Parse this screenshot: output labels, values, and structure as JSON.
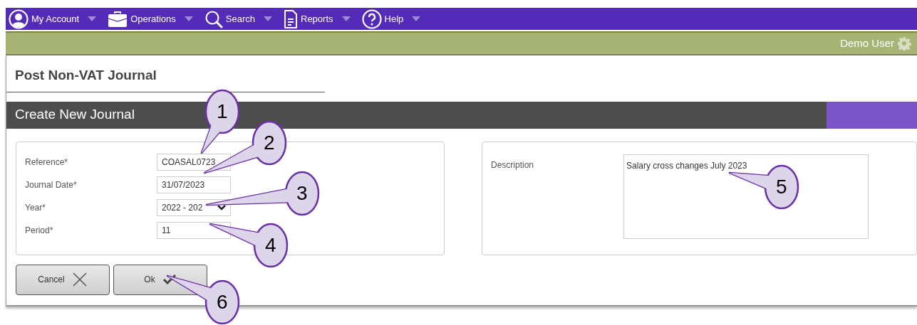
{
  "nav": {
    "items": [
      {
        "label": "My Account"
      },
      {
        "label": "Operations"
      },
      {
        "label": "Search"
      },
      {
        "label": "Reports"
      },
      {
        "label": "Help"
      }
    ]
  },
  "user_bar": {
    "user": "Demo User"
  },
  "page": {
    "title": "Post Non-VAT Journal"
  },
  "section": {
    "title": "Create New Journal"
  },
  "form": {
    "fields": [
      {
        "label": "Reference*",
        "value": "COASAL0723",
        "kind": "text"
      },
      {
        "label": "Journal Date*",
        "value": "31/07/2023",
        "kind": "text"
      },
      {
        "label": "Year*",
        "value": "2022 - 202",
        "kind": "select"
      },
      {
        "label": "Period*",
        "value": "11",
        "kind": "text"
      }
    ]
  },
  "description": {
    "label": "Description",
    "value": "Salary cross changes July 2023"
  },
  "buttons": [
    {
      "label": "Cancel",
      "kind": "cancel"
    },
    {
      "label": "Ok",
      "kind": "ok"
    }
  ],
  "annotations": [
    {
      "label": "1"
    },
    {
      "label": "2"
    },
    {
      "label": "3"
    },
    {
      "label": "4"
    },
    {
      "label": "5"
    },
    {
      "label": "6"
    }
  ]
}
